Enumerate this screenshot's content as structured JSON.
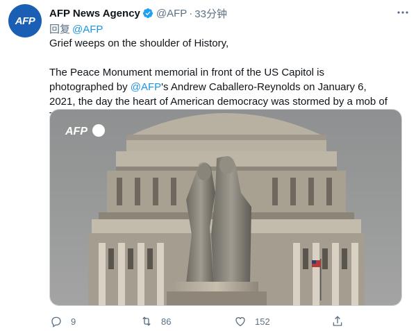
{
  "account": {
    "avatar_text": "AFP",
    "name": "AFP News Agency",
    "handle": "@AFP",
    "separator": "·",
    "time": "33分钟"
  },
  "reply": {
    "prefix": "回复",
    "mention": "@AFP"
  },
  "tweet": {
    "line1": "Grief weeps on the shoulder of History,",
    "line2_before": "The Peace Monument memorial in front of the US Capitol is photographed by ",
    "line2_mention": "@AFP",
    "line2_after": "'s Andrew Caballero-Reynolds on January 6, 2021, the day the heart of American democracy was stormed by a mob of Trump supporters"
  },
  "media": {
    "watermark": "AFP"
  },
  "actions": {
    "reply_count": "9",
    "retweet_count": "86",
    "like_count": "152"
  },
  "colors": {
    "link": "#1b95e0",
    "secondary_text": "#5b7083",
    "avatar_bg": "#1a5fb4",
    "verified": "#1da1f2"
  },
  "icons": {
    "verified": "verified-badge-icon",
    "more": "more-icon",
    "reply": "reply-icon",
    "retweet": "retweet-icon",
    "like": "heart-icon",
    "share": "share-icon"
  }
}
